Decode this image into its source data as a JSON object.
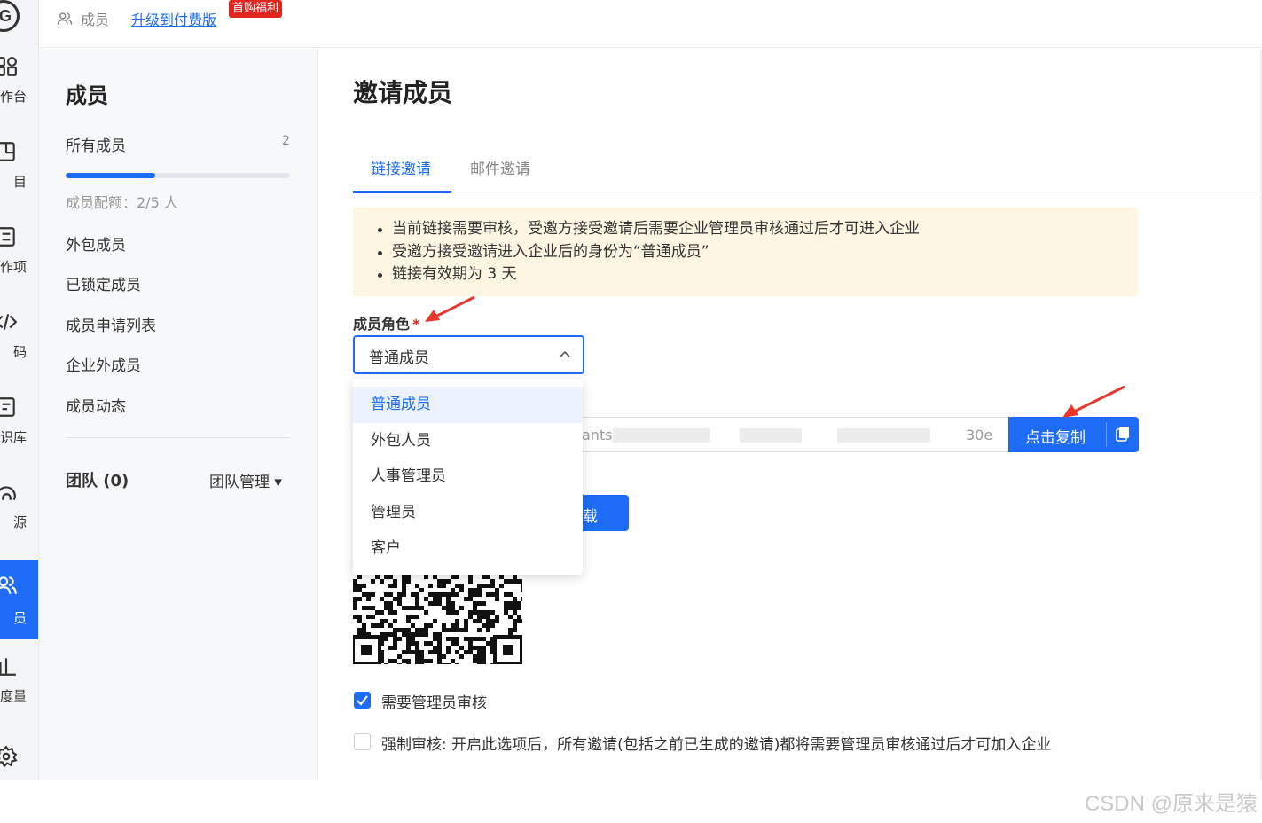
{
  "rail": {
    "logo": "G",
    "items": [
      {
        "label": "作台",
        "icon": "workbench-icon"
      },
      {
        "label": "目",
        "icon": "project-icon"
      },
      {
        "label": "作项",
        "icon": "work-item-icon"
      },
      {
        "label": "码",
        "icon": "code-icon"
      },
      {
        "label": "识库",
        "icon": "knowledge-icon"
      },
      {
        "label": "源",
        "icon": "resource-icon"
      },
      {
        "label": "员",
        "icon": "members-icon"
      },
      {
        "label": "度量",
        "icon": "metrics-icon"
      },
      {
        "label": "",
        "icon": "settings-icon"
      }
    ],
    "active_index": 6
  },
  "topbar": {
    "breadcrumb": "成员",
    "upgrade_link": "升级到付费版",
    "promo_badge": "首购福利"
  },
  "sidebar": {
    "title": "成员",
    "all_members": {
      "label": "所有成员",
      "count": "2"
    },
    "quota": {
      "label": "成员配额：2/5 人",
      "used": 2,
      "total": 5
    },
    "links": [
      "外包成员",
      "已锁定成员",
      "成员申请列表",
      "企业外成员",
      "成员动态"
    ],
    "team": {
      "label": "团队 (0)",
      "manage": "团队管理 ▾"
    }
  },
  "main": {
    "title": "邀请成员",
    "tabs": [
      {
        "label": "链接邀请",
        "active": true
      },
      {
        "label": "邮件邀请",
        "active": false
      }
    ],
    "notice": [
      "当前链接需要审核，受邀方接受邀请后需要企业管理员审核通过后才可进入企业",
      "受邀方接受邀请进入企业后的身份为“普通成员”",
      "链接有效期为 3 天"
    ],
    "role_field": {
      "label": "成员角色",
      "required_mark": "*",
      "value": "普通成员",
      "options": [
        "普通成员",
        "外包人员",
        "人事管理员",
        "管理员",
        "客户"
      ],
      "selected_index": 0
    },
    "invite_link": {
      "prefix_fragment": "ants",
      "suffix_fragment": "30e",
      "copy_label": "点击复制"
    },
    "download_label": "载",
    "checkbox_review": {
      "label": "需要管理员审核",
      "checked": true
    },
    "checkbox_force": {
      "label": "强制审核: 开启此选项后，所有邀请(包括之前已生成的邀请)都将需要管理员审核通过后才可加入企业",
      "checked": false
    }
  },
  "watermark": "CSDN @原来是猿",
  "colors": {
    "primary": "#1e6cf5",
    "notice_bg": "#fdf6e3",
    "badge_red": "#e0261e",
    "annotation_arrow": "#e8372c"
  }
}
